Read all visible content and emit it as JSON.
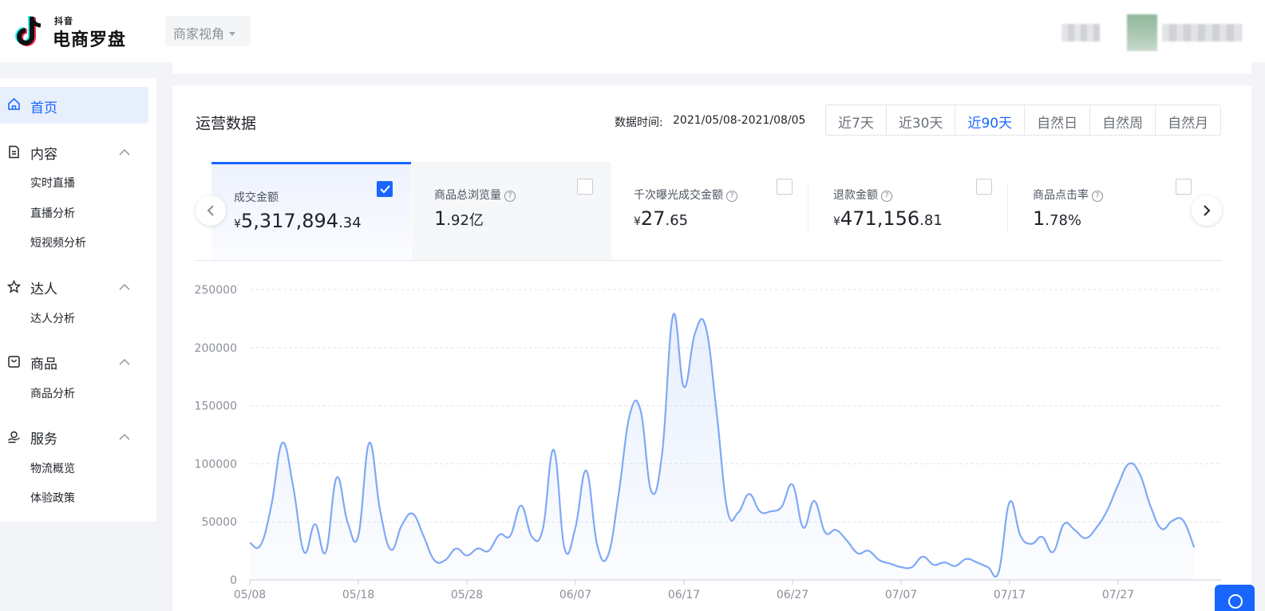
{
  "app": {
    "logo_small": "抖音",
    "logo_big": "电商罗盘",
    "view_select": "商家视角"
  },
  "sidebar": {
    "home": "首页",
    "groups": [
      {
        "label": "内容",
        "icon": "document-icon",
        "items": [
          "实时直播",
          "直播分析",
          "短视频分析"
        ]
      },
      {
        "label": "达人",
        "icon": "star-person-icon",
        "items": [
          "达人分析"
        ]
      },
      {
        "label": "商品",
        "icon": "bag-icon",
        "items": [
          "商品分析"
        ]
      },
      {
        "label": "服务",
        "icon": "service-icon",
        "items": [
          "物流概览",
          "体验政策"
        ]
      }
    ]
  },
  "card": {
    "title": "运营数据",
    "date_label": "数据时间:",
    "date_range": "2021/05/08-2021/08/05",
    "ranges": [
      "近7天",
      "近30天",
      "近90天",
      "自然日",
      "自然周",
      "自然月"
    ],
    "active_range": "近90天"
  },
  "metrics": [
    {
      "label": "成交金额",
      "currency": "¥",
      "int": "5,317,894",
      "dec": ".34",
      "help": false,
      "checked": true
    },
    {
      "label": "商品总浏览量",
      "currency": "",
      "int": "1",
      "dec": ".92亿",
      "help": true,
      "checked": false
    },
    {
      "label": "千次曝光成交金额",
      "currency": "¥",
      "int": "27",
      "dec": ".65",
      "help": true,
      "checked": false
    },
    {
      "label": "退款金额",
      "currency": "¥",
      "int": "471,156",
      "dec": ".81",
      "help": true,
      "checked": false
    },
    {
      "label": "商品点击率",
      "currency": "",
      "int": "1",
      "dec": ".78%",
      "help": true,
      "checked": false
    }
  ],
  "help_mark": "?",
  "colors": {
    "accent": "#1966ff",
    "line": "#7fa9f5"
  },
  "chart_data": {
    "type": "area",
    "ylim": [
      0,
      250000
    ],
    "y_ticks": [
      0,
      50000,
      100000,
      150000,
      200000,
      250000
    ],
    "x_ticks": [
      "05/08",
      "05/18",
      "05/28",
      "06/07",
      "06/17",
      "06/27",
      "07/07",
      "07/17",
      "07/27"
    ],
    "x": [
      "05/08",
      "05/09",
      "05/10",
      "05/11",
      "05/12",
      "05/13",
      "05/14",
      "05/15",
      "05/16",
      "05/17",
      "05/18",
      "05/19",
      "05/20",
      "05/21",
      "05/22",
      "05/23",
      "05/24",
      "05/25",
      "05/26",
      "05/27",
      "05/28",
      "05/29",
      "05/30",
      "05/31",
      "06/01",
      "06/02",
      "06/03",
      "06/04",
      "06/05",
      "06/06",
      "06/07",
      "06/08",
      "06/09",
      "06/10",
      "06/11",
      "06/12",
      "06/13",
      "06/14",
      "06/15",
      "06/16",
      "06/17",
      "06/18",
      "06/19",
      "06/20",
      "06/21",
      "06/22",
      "06/23",
      "06/24",
      "06/25",
      "06/26",
      "06/27",
      "06/28",
      "06/29",
      "06/30",
      "07/01",
      "07/02",
      "07/03",
      "07/04",
      "07/05",
      "07/06",
      "07/07",
      "07/08",
      "07/09",
      "07/10",
      "07/11",
      "07/12",
      "07/13",
      "07/14",
      "07/15",
      "07/16",
      "07/17",
      "07/18",
      "07/19",
      "07/20",
      "07/21",
      "07/22",
      "07/23",
      "07/24",
      "07/25",
      "07/26",
      "07/27",
      "07/28",
      "07/29",
      "07/30",
      "07/31",
      "08/01",
      "08/02",
      "08/03",
      "08/04",
      "08/05"
    ],
    "values": [
      32000,
      30000,
      65000,
      118000,
      80000,
      24000,
      48000,
      24000,
      88000,
      50000,
      38000,
      118000,
      60000,
      26000,
      47000,
      57000,
      38000,
      17000,
      17000,
      27000,
      21000,
      27000,
      25000,
      39000,
      38000,
      64000,
      37000,
      44000,
      112000,
      27000,
      45000,
      94000,
      30000,
      21000,
      75000,
      142000,
      146000,
      76000,
      110000,
      228000,
      166000,
      212000,
      218000,
      145000,
      60000,
      58000,
      74000,
      59000,
      59000,
      63000,
      82000,
      45000,
      68000,
      41000,
      43000,
      34000,
      23000,
      25000,
      17000,
      14000,
      11000,
      11000,
      20000,
      13000,
      15000,
      12000,
      18000,
      15000,
      11000,
      7000,
      67000,
      38000,
      31000,
      37000,
      24000,
      48000,
      43000,
      36000,
      45000,
      60000,
      82000,
      100000,
      91000,
      63000,
      44000,
      51000,
      51000,
      28000
    ]
  }
}
